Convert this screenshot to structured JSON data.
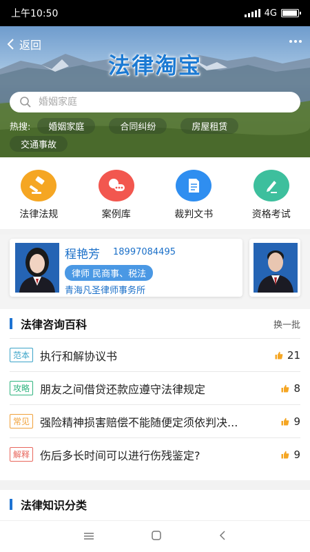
{
  "status_bar": {
    "time": "上午10:50",
    "network": "4G"
  },
  "header": {
    "back_label": "返回",
    "title": "法律淘宝"
  },
  "search": {
    "placeholder": "婚姻家庭"
  },
  "hot_search": {
    "label": "热搜:",
    "tags": [
      "婚姻家庭",
      "合同纠纷",
      "房屋租赁",
      "交通事故"
    ]
  },
  "quick_links": [
    {
      "label": "法律法规",
      "icon": "gavel-icon",
      "color": "#f5a623"
    },
    {
      "label": "案例库",
      "icon": "chat-dots-icon",
      "color": "#f2574f"
    },
    {
      "label": "裁判文书",
      "icon": "document-icon",
      "color": "#2f8ef0"
    },
    {
      "label": "资格考试",
      "icon": "edit-icon",
      "color": "#3dbf9d"
    }
  ],
  "lawyer": {
    "name": "程艳芳",
    "phone": "18997084495",
    "tag": "律师 民商事、税法",
    "firm": "青海凡圣律师事务所"
  },
  "encyclopedia": {
    "title": "法律咨询百科",
    "refresh_label": "换一批",
    "items": [
      {
        "tag": "范本",
        "tag_color": "#3aa3c8",
        "text": "执行和解协议书",
        "likes": "21"
      },
      {
        "tag": "攻略",
        "tag_color": "#2fb37e",
        "text": "朋友之间借贷还款应遵守法律规定",
        "likes": "8"
      },
      {
        "tag": "常见",
        "tag_color": "#f0a038",
        "text": "强险精神损害赔偿不能随便定须依判决...",
        "likes": "9"
      },
      {
        "tag": "解释",
        "tag_color": "#e8665c",
        "text": "伤后多长时间可以进行伤残鉴定?",
        "likes": "9"
      }
    ]
  },
  "knowledge": {
    "title": "法律知识分类"
  },
  "colors": {
    "accent": "#1e73d2",
    "like": "#f5a623"
  }
}
